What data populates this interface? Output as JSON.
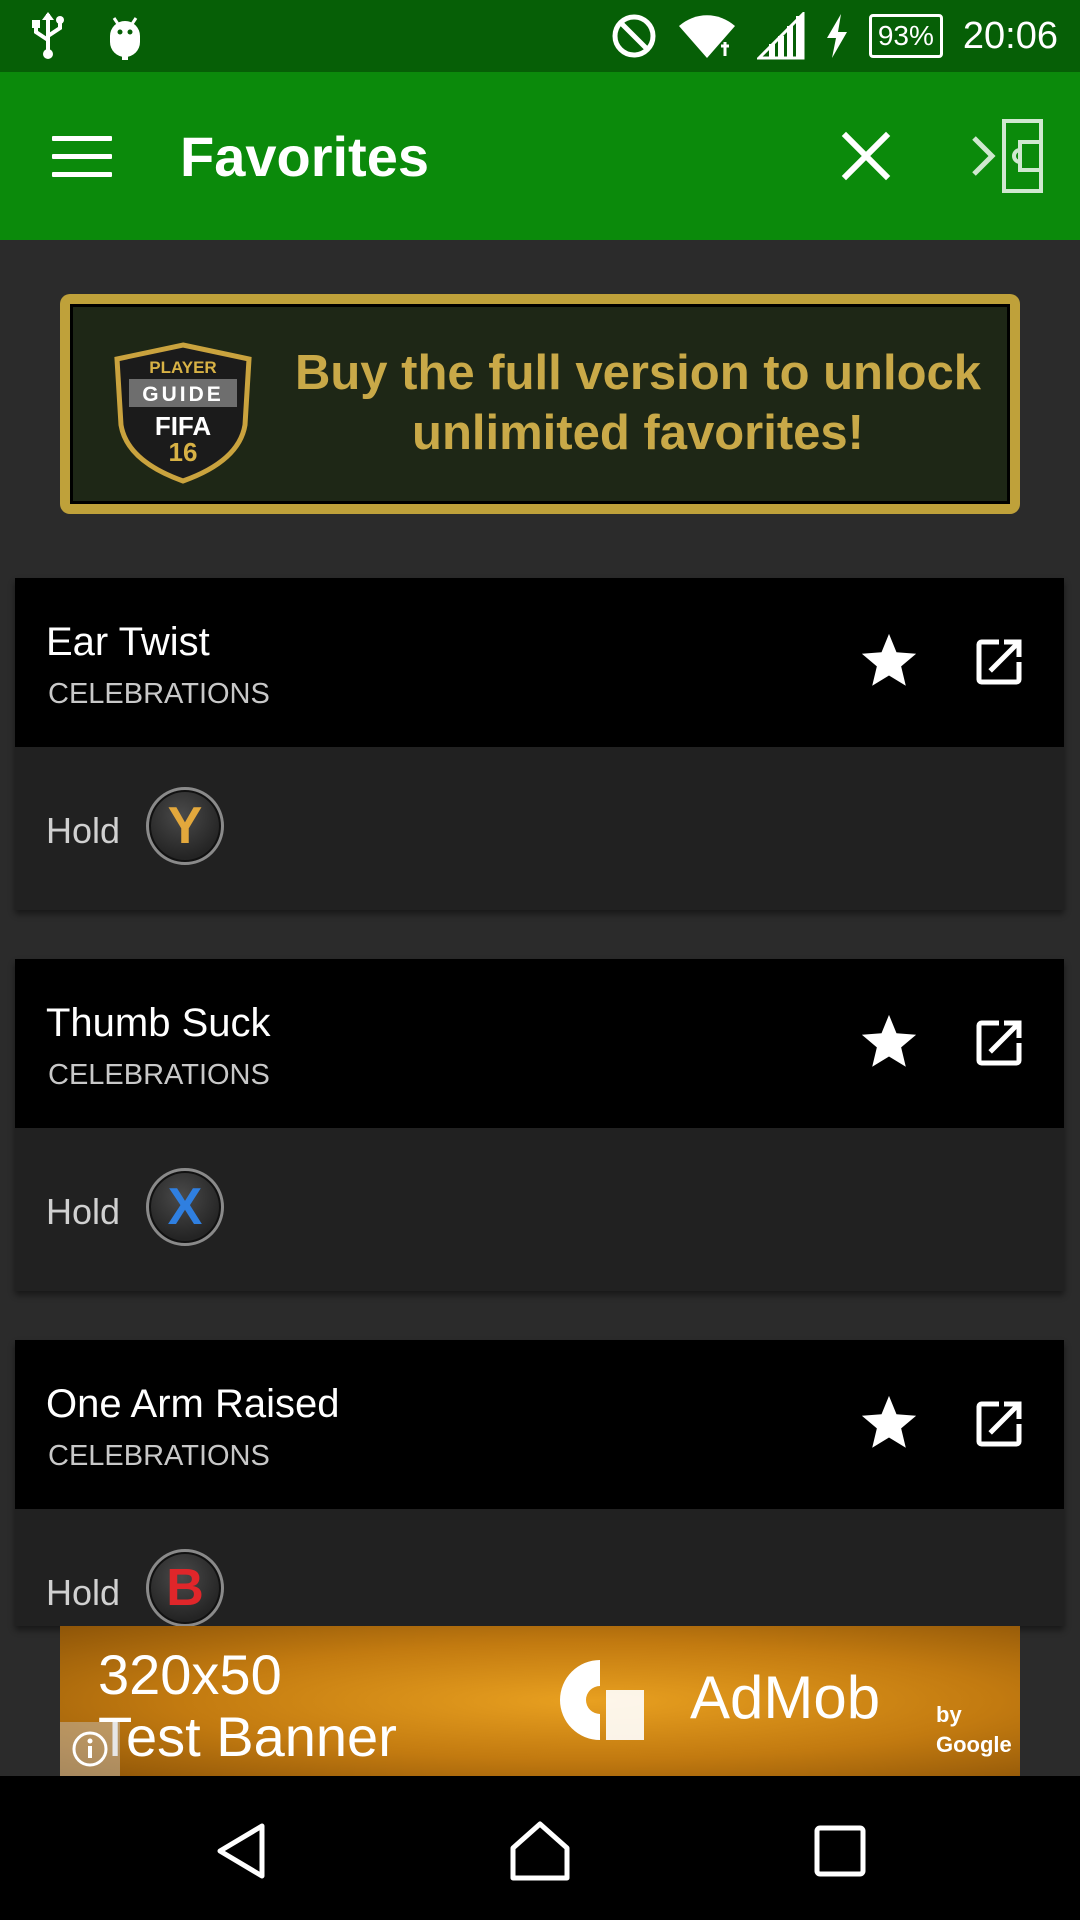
{
  "status_bar": {
    "time": "20:06",
    "battery": "93%",
    "left_icons": [
      "usb-icon",
      "android-debug-icon"
    ],
    "right_icons": [
      "do-not-disturb-icon",
      "wifi-icon",
      "cell-signal-icon",
      "charging-icon"
    ]
  },
  "app_bar": {
    "title": "Favorites",
    "menu_icon": "hamburger-menu-icon",
    "close_icon": "close-icon",
    "exit_icon": "exit-pitch-icon",
    "background": "#0b8a0b"
  },
  "promo": {
    "text": "Buy the full version to unlock unlimited favorites!",
    "logo": {
      "line1": "PLAYER",
      "line2": "GUIDE",
      "line3": "FIFA",
      "line4": "16"
    }
  },
  "favorites": [
    {
      "title": "Ear Twist",
      "category": "CELEBRATIONS",
      "action": "Hold",
      "button": "Y"
    },
    {
      "title": "Thumb Suck",
      "category": "CELEBRATIONS",
      "action": "Hold",
      "button": "X"
    },
    {
      "title": "One Arm Raised",
      "category": "CELEBRATIONS",
      "action": "Hold",
      "button": "B"
    }
  ],
  "ad": {
    "text_line1": "320x50",
    "text_line2": "Test Banner",
    "brand": "AdMob",
    "brand_sub": "by Google"
  },
  "nav_bar": {
    "icons": [
      "back-icon",
      "home-icon",
      "recents-icon"
    ]
  }
}
